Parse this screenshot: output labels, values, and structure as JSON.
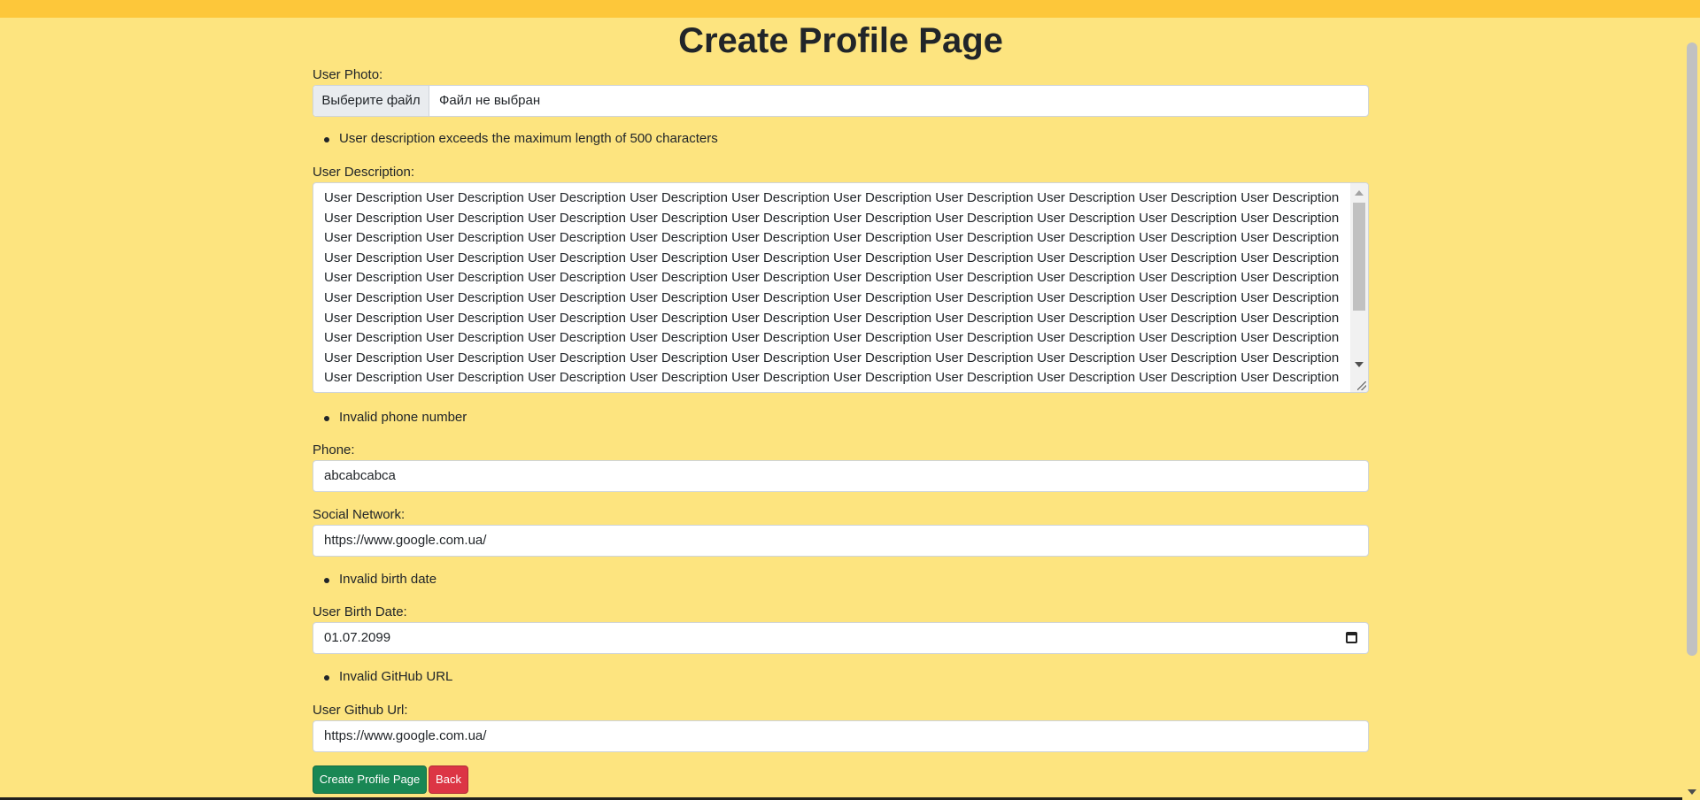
{
  "page": {
    "title": "Create Profile Page"
  },
  "photo": {
    "label": "User Photo:",
    "button": "Выберите файл",
    "status": "Файл не выбран"
  },
  "description": {
    "error": "User description exceeds the maximum length of 500 characters",
    "label": "User Description:",
    "value": "User Description User Description User Description User Description User Description User Description User Description User Description User Description User Description User Description User Description User Description User Description User Description User Description User Description User Description User Description User Description User Description User Description User Description User Description User Description User Description User Description User Description User Description User Description User Description User Description User Description User Description User Description User Description User Description User Description User Description User Description User Description User Description User Description User Description User Description User Description User Description User Description User Description User Description User Description User Description User Description User Description User Description User Description User Description User Description User Description User Description User Description User Description User Description User Description User Description User Description User Description User Description User Description User Description User Description User Description User Description User Description User Description User Description User Description User Description User Description User Description User Description User Description User Description User Description User Description User Description User Description User Description User Description User Description User Description User Description User Description User Description User Description User Description User Description User Description User Description User Description User Description User Description"
  },
  "phone": {
    "error": "Invalid phone number",
    "label": "Phone:",
    "value": "abcabcabca"
  },
  "social": {
    "label": "Social Network:",
    "value": "https://www.google.com.ua/"
  },
  "birth": {
    "error": "Invalid birth date",
    "label": "User Birth Date:",
    "value": "01.07.2099"
  },
  "github": {
    "error": "Invalid GitHub URL",
    "label": "User Github Url:",
    "value": "https://www.google.com.ua/"
  },
  "actions": {
    "submit": "Create Profile Page",
    "back": "Back"
  },
  "colors": {
    "background": "#fde47f",
    "topbar": "#fdc73a",
    "submit": "#198754",
    "back": "#dc3545"
  }
}
